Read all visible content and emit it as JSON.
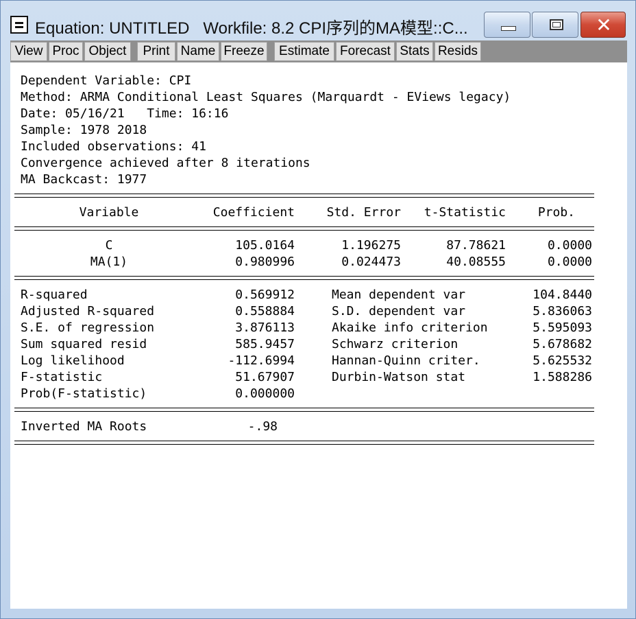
{
  "window": {
    "title": "Equation: UNTITLED   Workfile: 8.2 CPI序列的MA模型::C..."
  },
  "toolbar": {
    "buttons": [
      "View",
      "Proc",
      "Object",
      "Print",
      "Name",
      "Freeze",
      "Estimate",
      "Forecast",
      "Stats",
      "Resids"
    ]
  },
  "header_lines": [
    "Dependent Variable: CPI",
    "Method: ARMA Conditional Least Squares (Marquardt - EViews legacy)",
    "Date: 05/16/21   Time: 16:16",
    "Sample: 1978 2018",
    "Included observations: 41",
    "Convergence achieved after 8 iterations",
    "MA Backcast: 1977"
  ],
  "coef_table": {
    "headers": [
      "Variable",
      "Coefficient",
      "Std. Error",
      "t-Statistic",
      "Prob."
    ],
    "rows": [
      [
        "C",
        "105.0164",
        "1.196275",
        "87.78621",
        "0.0000"
      ],
      [
        "MA(1)",
        "0.980996",
        "0.024473",
        "40.08555",
        "0.0000"
      ]
    ]
  },
  "stats": {
    "left": [
      [
        "R-squared",
        "0.569912"
      ],
      [
        "Adjusted R-squared",
        "0.558884"
      ],
      [
        "S.E. of regression",
        "3.876113"
      ],
      [
        "Sum squared resid",
        "585.9457"
      ],
      [
        "Log likelihood",
        "-112.6994"
      ],
      [
        "F-statistic",
        "51.67907"
      ],
      [
        "Prob(F-statistic)",
        "0.000000"
      ]
    ],
    "right": [
      [
        "Mean dependent var",
        "104.8440"
      ],
      [
        "S.D. dependent var",
        "5.836063"
      ],
      [
        "Akaike info criterion",
        "5.595093"
      ],
      [
        "Schwarz criterion",
        "5.678682"
      ],
      [
        "Hannan-Quinn criter.",
        "5.625532"
      ],
      [
        "Durbin-Watson stat",
        "1.588286"
      ]
    ]
  },
  "roots": {
    "label": "Inverted MA Roots",
    "value": "-.98"
  }
}
